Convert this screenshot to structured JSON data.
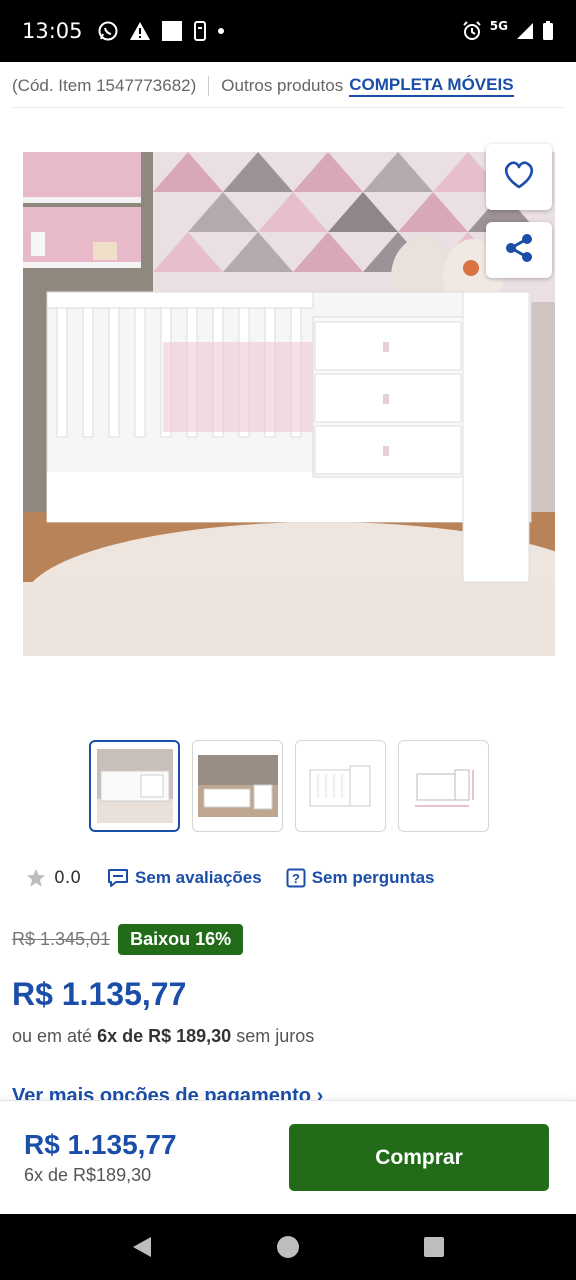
{
  "status_bar": {
    "time": "13:05",
    "network": "5G",
    "icons": [
      "whatsapp-icon",
      "warning-icon",
      "square-icon",
      "phone-icon",
      "dot-icon",
      "alarm-icon",
      "signal-icon",
      "battery-icon"
    ]
  },
  "item_line": {
    "code": "(Cód. Item 1547773682)",
    "other_products": "Outros produtos",
    "brand": "COMPLETA MÓVEIS"
  },
  "product": {
    "image": "crib-photo",
    "actions": [
      "heart-icon",
      "share-icon"
    ],
    "thumbnails": [
      "thumb-1",
      "thumb-2",
      "thumb-3",
      "thumb-4"
    ]
  },
  "rating": {
    "value": "0.0",
    "reviews_label": "Sem avaliações",
    "questions_label": "Sem perguntas"
  },
  "pricing": {
    "old_price": "R$ 1.345,01",
    "discount": "Baixou 16%",
    "price": "R$ 1.135,77",
    "installments_prefix": "ou em até",
    "installments_value": "6x de R$ 189,30",
    "installments_suffix": "sem juros",
    "more_payments": "Ver mais opções de pagamento"
  },
  "buy_bar": {
    "price": "R$ 1.135,77",
    "installments": "6x de R$189,30",
    "button_label": "Comprar"
  },
  "colors": {
    "brand_blue": "#1b4ea8",
    "buy_green": "#226c19"
  }
}
